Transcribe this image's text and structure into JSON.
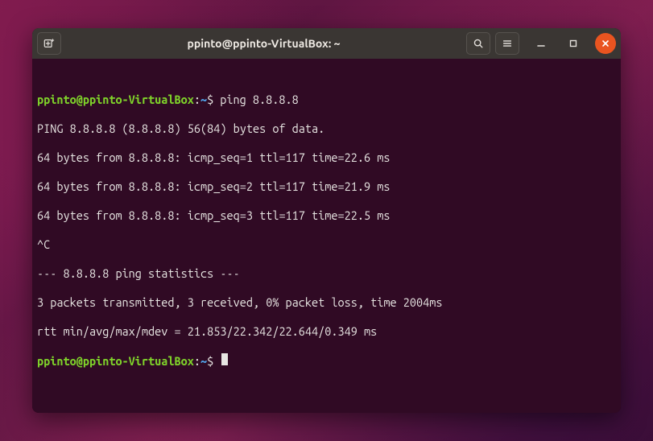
{
  "window": {
    "title": "ppinto@ppinto-VirtualBox: ~"
  },
  "prompt": {
    "user_host": "ppinto@ppinto-VirtualBox",
    "sep1": ":",
    "cwd": "~",
    "sigil": "$"
  },
  "session": {
    "command1": "ping 8.8.8.8",
    "output_lines": [
      "PING 8.8.8.8 (8.8.8.8) 56(84) bytes of data.",
      "64 bytes from 8.8.8.8: icmp_seq=1 ttl=117 time=22.6 ms",
      "64 bytes from 8.8.8.8: icmp_seq=2 ttl=117 time=21.9 ms",
      "64 bytes from 8.8.8.8: icmp_seq=3 ttl=117 time=22.5 ms",
      "^C",
      "--- 8.8.8.8 ping statistics ---",
      "3 packets transmitted, 3 received, 0% packet loss, time 2004ms",
      "rtt min/avg/max/mdev = 21.853/22.342/22.644/0.349 ms"
    ],
    "command2": ""
  },
  "icons": {
    "new_tab": "new-tab-icon",
    "search": "search-icon",
    "menu": "hamburger-icon",
    "minimize": "minimize-icon",
    "maximize": "maximize-icon",
    "close": "close-icon"
  },
  "colors": {
    "titlebar_bg": "#3a3633",
    "terminal_bg": "#300a24",
    "prompt_host": "#7fd32a",
    "prompt_cwd": "#4f9ee3",
    "text": "#e8e6e3",
    "close_btn": "#e95420"
  }
}
